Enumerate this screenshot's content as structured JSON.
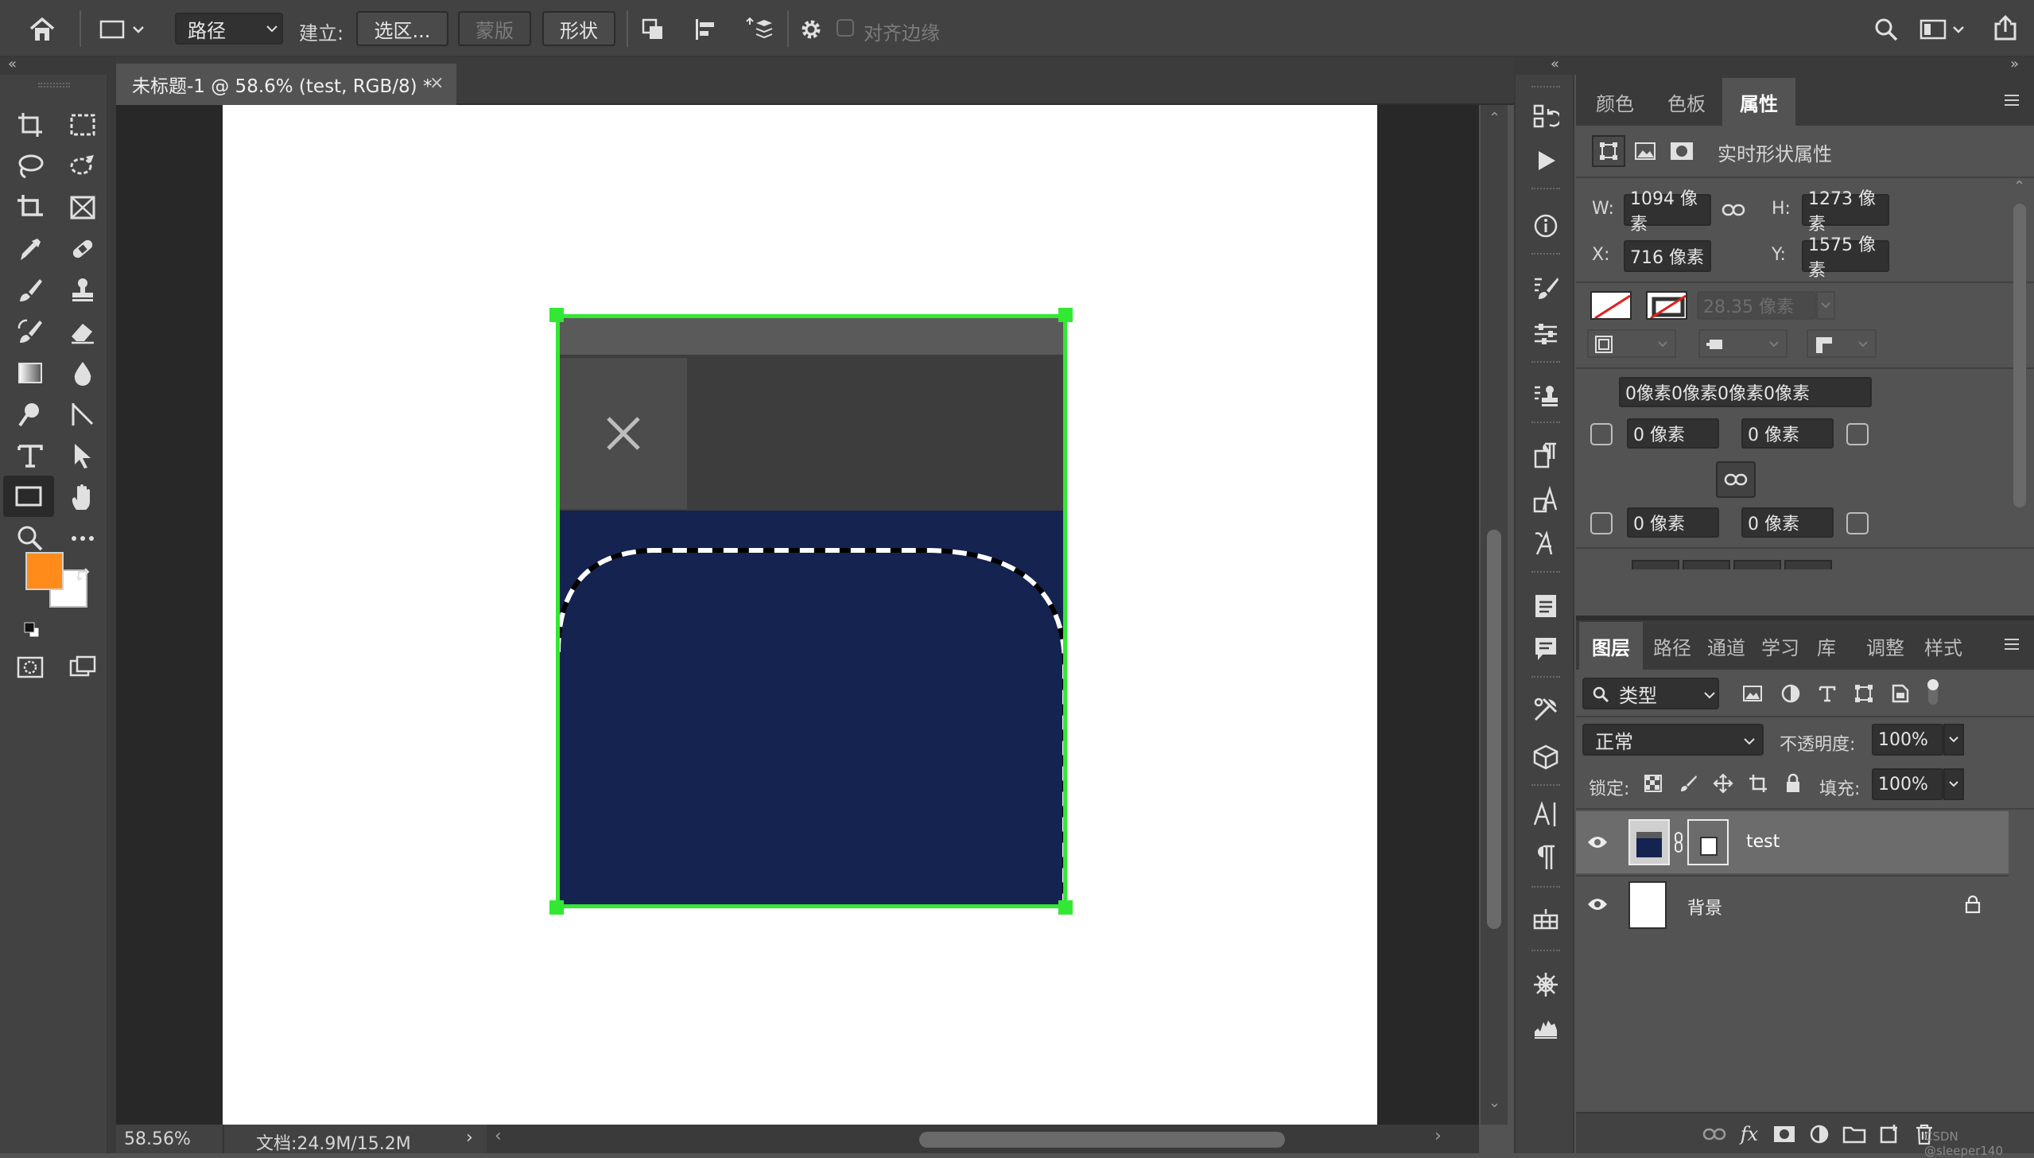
{
  "options_bar": {
    "mode_dropdown": "路径",
    "make_label": "建立:",
    "selection_button": "选区...",
    "mask_button": "蒙版",
    "shape_button": "形状",
    "align_edges_label": "对齐边缘"
  },
  "document": {
    "tab_title": "未标题-1 @ 58.6% (test, RGB/8) *",
    "zoom": "58.56%",
    "doc_size": "文档:24.9M/15.2M"
  },
  "swatches": {
    "foreground": "#ff8c1a",
    "background": "#ffffff"
  },
  "colors": {
    "selection_handles": "#33e833",
    "shape_fill": "#14234f",
    "canvas": "#ffffff"
  },
  "properties_panel": {
    "tabs": [
      "颜色",
      "色板",
      "属性"
    ],
    "active_tab": "属性",
    "section_title": "实时形状属性",
    "w_label": "W:",
    "w_value": "1094 像素",
    "h_label": "H:",
    "h_value": "1273 像素",
    "x_label": "X:",
    "x_value": "716 像素",
    "y_label": "Y:",
    "y_value": "1575 像素",
    "stroke_width": "28.35 像素",
    "corner_all": "0像素0像素0像素0像素",
    "corner_tl": "0 像素",
    "corner_tr": "0 像素",
    "corner_bl": "0 像素",
    "corner_br": "0 像素"
  },
  "layers_panel": {
    "tabs": [
      "图层",
      "路径",
      "通道",
      "学习",
      "库",
      "调整",
      "样式"
    ],
    "active_tab": "图层",
    "filter_label": "类型",
    "blend_mode": "正常",
    "opacity_label": "不透明度:",
    "opacity_value": "100%",
    "lock_label": "锁定:",
    "fill_label": "填充:",
    "fill_value": "100%",
    "layers": [
      {
        "name": "test",
        "visible": true,
        "selected": true
      },
      {
        "name": "背景",
        "visible": true,
        "locked": true
      }
    ]
  },
  "watermark": "CSDN @sleeper140"
}
